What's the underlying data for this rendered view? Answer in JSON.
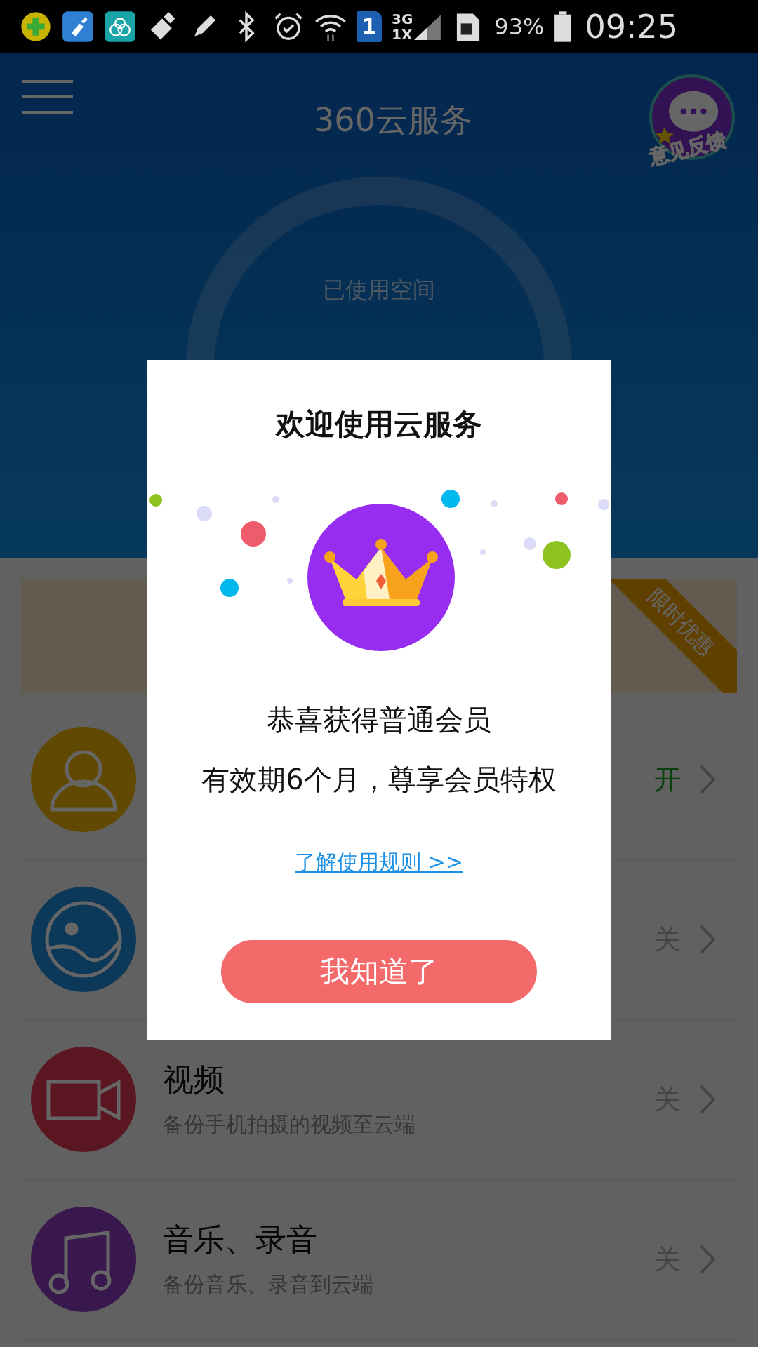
{
  "status_bar": {
    "sim": "1",
    "network_top": "3G",
    "network_bottom": "1X",
    "battery": "93%",
    "time": "09:25"
  },
  "header": {
    "title": "360云服务",
    "feedback_label": "意见反馈"
  },
  "storage": {
    "label": "已使用空间"
  },
  "banner": {
    "ribbon": "限时优惠"
  },
  "backup_items": [
    {
      "kind": "contacts",
      "on": true,
      "status": "开"
    },
    {
      "kind": "photos",
      "on": false,
      "status": "关"
    },
    {
      "kind": "video",
      "title": "视频",
      "subtitle": "备份手机拍摄的视频至云端",
      "on": false,
      "status": "关"
    },
    {
      "kind": "music",
      "title": "音乐、录音",
      "subtitle": "备份音乐、录音到云端",
      "on": false,
      "status": "关"
    }
  ],
  "dialog": {
    "title": "欢迎使用云服务",
    "message_lines": [
      "恭喜获得普通会员",
      "有效期6个月，尊享会员特权"
    ],
    "link": "了解使用规则 >>",
    "button": "我知道了"
  }
}
